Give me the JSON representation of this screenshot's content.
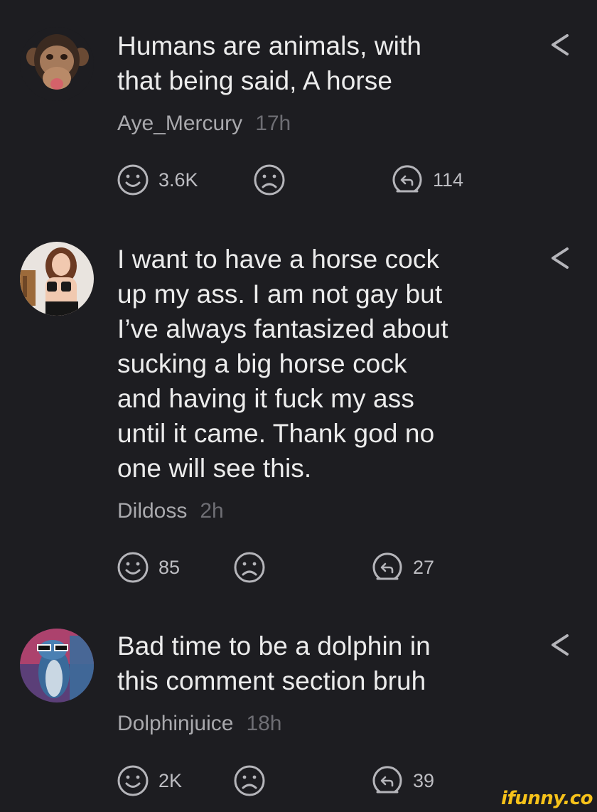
{
  "comments": [
    {
      "text_lines": [
        "Humans are animals, with",
        "that being said, A horse"
      ],
      "username": "Aye_Mercury",
      "time": "17h",
      "smile_count": "3.6K",
      "reply_count": "114"
    },
    {
      "text_lines": [
        "I want to have a horse cock",
        "up my ass. I am not gay but",
        "I’ve always fantasized about",
        "sucking a big horse cock",
        "and having it fuck my ass",
        "until it came. Thank god no",
        "one will see this."
      ],
      "username": "Dildoss",
      "time": "2h",
      "smile_count": "85",
      "reply_count": "27"
    },
    {
      "text_lines": [
        "Bad time to be a dolphin in",
        "this comment section bruh"
      ],
      "username": "Dolphinjuice",
      "time": "18h",
      "smile_count": "2K",
      "reply_count": "39"
    }
  ],
  "icons": {
    "smile": "smile-icon",
    "unsmile": "unsmile-icon",
    "reply": "reply-icon",
    "share": "share-icon"
  },
  "colors": {
    "background": "#1d1d21",
    "text": "#ececec",
    "username": "#a9a9ad",
    "time": "#6e6e74",
    "icon": "#b5b5ba",
    "brand": "#f6c21a"
  },
  "watermark": "ifunny.co"
}
